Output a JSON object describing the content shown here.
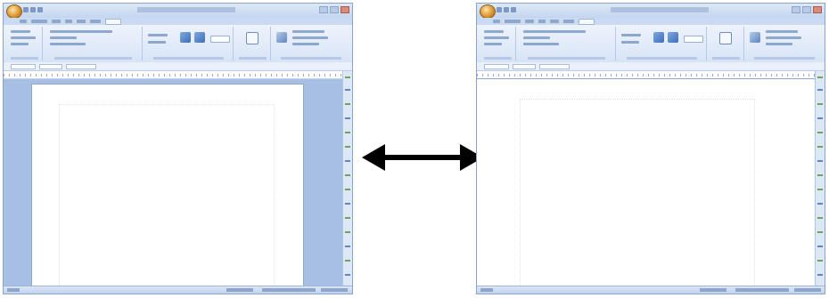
{
  "windows": [
    {
      "id": "left",
      "view": "print-layout-with-margins",
      "icons": {
        "office_button": "office-orb-icon",
        "quick_access": [
          "save-icon",
          "undo-icon",
          "redo-icon"
        ],
        "window_controls": [
          "minimize-icon",
          "maximize-icon",
          "close-icon"
        ]
      }
    },
    {
      "id": "right",
      "view": "page-fills-window",
      "icons": {
        "office_button": "office-orb-icon",
        "quick_access": [
          "save-icon",
          "undo-icon",
          "redo-icon"
        ],
        "window_controls": [
          "minimize-icon",
          "maximize-icon",
          "close-icon"
        ]
      }
    }
  ],
  "connector": {
    "icon": "double-headed-arrow-icon",
    "color": "#000000"
  },
  "colors": {
    "frame": "#d4e1f3",
    "workspace": "#a6bfe3",
    "page": "#ffffff"
  }
}
